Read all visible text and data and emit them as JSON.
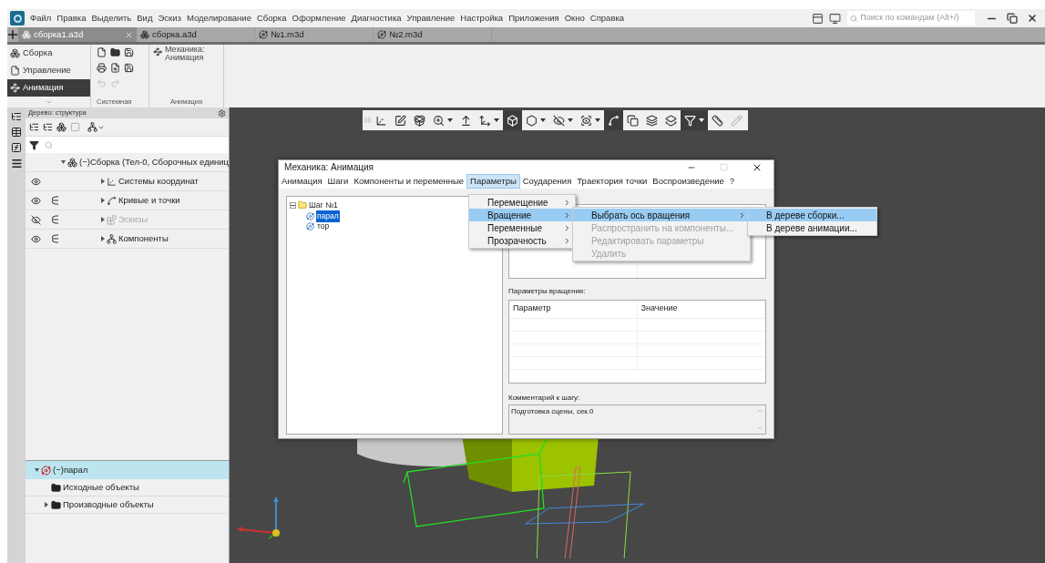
{
  "app_menu": [
    "Файл",
    "Правка",
    "Выделить",
    "Вид",
    "Эскиз",
    "Моделирование",
    "Сборка",
    "Оформление",
    "Диагностика",
    "Управление",
    "Настройка",
    "Приложения",
    "Окно",
    "Справка"
  ],
  "command_search": {
    "placeholder": "Поиск по командам (Alt+/)"
  },
  "document_tabs": [
    {
      "label": "сборка1.a3d",
      "selected": true,
      "kind": "assembly"
    },
    {
      "label": "сборка.a3d",
      "selected": false,
      "kind": "assembly"
    },
    {
      "label": "№1.m3d",
      "selected": false,
      "kind": "part"
    },
    {
      "label": "№2.m3d",
      "selected": false,
      "kind": "part"
    }
  ],
  "ribbon": {
    "sections": [
      {
        "label": "Сборка",
        "selected": false
      },
      {
        "label": "Управление",
        "selected": false
      },
      {
        "label": "Анимация",
        "selected": true
      }
    ],
    "command": "Механика: Анимация",
    "groups": [
      "Системная",
      "Анимация"
    ]
  },
  "tree_panel": {
    "title": "Дерево: структура",
    "rows": [
      {
        "label": "(−)Сборка (Тел-0, Сборочных единиц",
        "eye_toggle": false,
        "included": false,
        "hidden": false,
        "children": [
          {
            "label": "Системы координат",
            "eye_toggle": true,
            "included": false,
            "hidden": false
          },
          {
            "label": "Кривые и точки",
            "eye_toggle": true,
            "included": true,
            "hidden": false
          },
          {
            "label": "Эскизы",
            "eye_toggle": true,
            "included": true,
            "hidden": true
          },
          {
            "label": "Компоненты",
            "eye_toggle": true,
            "included": true,
            "hidden": false
          }
        ]
      }
    ],
    "detail": [
      {
        "label": "(−)парал",
        "selected": true,
        "expanded": true,
        "children": [
          {
            "label": "Исходные объекты",
            "expandable": false
          },
          {
            "label": "Производные объекты",
            "expandable": true
          }
        ]
      }
    ]
  },
  "viewport_toolbar": [
    {
      "pressed": false,
      "dropdown": false
    },
    {
      "pressed": false,
      "dropdown": false
    },
    {
      "pressed": false,
      "dropdown": false
    },
    {
      "pressed": false,
      "dropdown": true
    },
    {
      "pressed": false,
      "dropdown": false
    },
    {
      "pressed": false,
      "dropdown": true
    },
    {
      "pressed": true,
      "dropdown": false
    },
    {
      "pressed": false,
      "dropdown": true
    },
    {
      "pressed": false,
      "dropdown": true
    },
    {
      "pressed": false,
      "dropdown": true
    },
    {
      "pressed": true,
      "dropdown": false
    },
    {
      "pressed": false,
      "dropdown": false
    },
    {
      "pressed": false,
      "dropdown": false
    },
    {
      "pressed": false,
      "dropdown": false
    },
    {
      "pressed": true,
      "dropdown": true
    },
    {
      "pressed": false,
      "dropdown": false
    },
    {
      "pressed": false,
      "dropdown": false
    }
  ],
  "dialog": {
    "title": "Механика: Анимация",
    "menu": [
      {
        "label": "Анимация",
        "selected": false
      },
      {
        "label": "Шаги",
        "selected": false
      },
      {
        "label": "Компоненты и переменные",
        "selected": false
      },
      {
        "label": "Параметры",
        "selected": true
      },
      {
        "label": "Соударения",
        "selected": false
      },
      {
        "label": "Траектория точки",
        "selected": false
      },
      {
        "label": "Воспроизведение",
        "selected": false
      },
      {
        "label": "?",
        "selected": false
      }
    ],
    "steps": [
      {
        "label": "Шаг №1",
        "expanded": true,
        "children": [
          {
            "label": "парал",
            "selected": true
          },
          {
            "label": "тор",
            "selected": false
          }
        ]
      }
    ],
    "rotation_label": "Параметры вращения:",
    "rotation_columns": [
      "Параметр",
      "Значение"
    ],
    "comment_label": "Комментарий к шагу:",
    "comment": "Подготовка сцены, сек.0"
  },
  "menus": [
    [
      {
        "label": "Перемещение",
        "highlighted": false,
        "disabled": false,
        "submenu": true
      },
      {
        "label": "Вращение",
        "highlighted": true,
        "disabled": false,
        "submenu": true
      },
      {
        "label": "Переменные",
        "highlighted": false,
        "disabled": false,
        "submenu": true
      },
      {
        "label": "Прозрачность",
        "highlighted": false,
        "disabled": false,
        "submenu": true
      }
    ],
    [
      {
        "label": "Выбрать ось вращения",
        "highlighted": true,
        "disabled": false,
        "submenu": true
      },
      {
        "label": "Распространить на компоненты...",
        "highlighted": false,
        "disabled": true,
        "submenu": false
      },
      {
        "label": "Редактировать параметры",
        "highlighted": false,
        "disabled": true,
        "submenu": false
      },
      {
        "label": "Удалить",
        "highlighted": false,
        "disabled": true,
        "submenu": false
      }
    ],
    [
      {
        "label": "В дереве сборки...",
        "highlighted": true,
        "disabled": false,
        "submenu": false
      },
      {
        "label": "В дереве анимации...",
        "highlighted": false,
        "disabled": false,
        "submenu": false
      }
    ]
  ]
}
